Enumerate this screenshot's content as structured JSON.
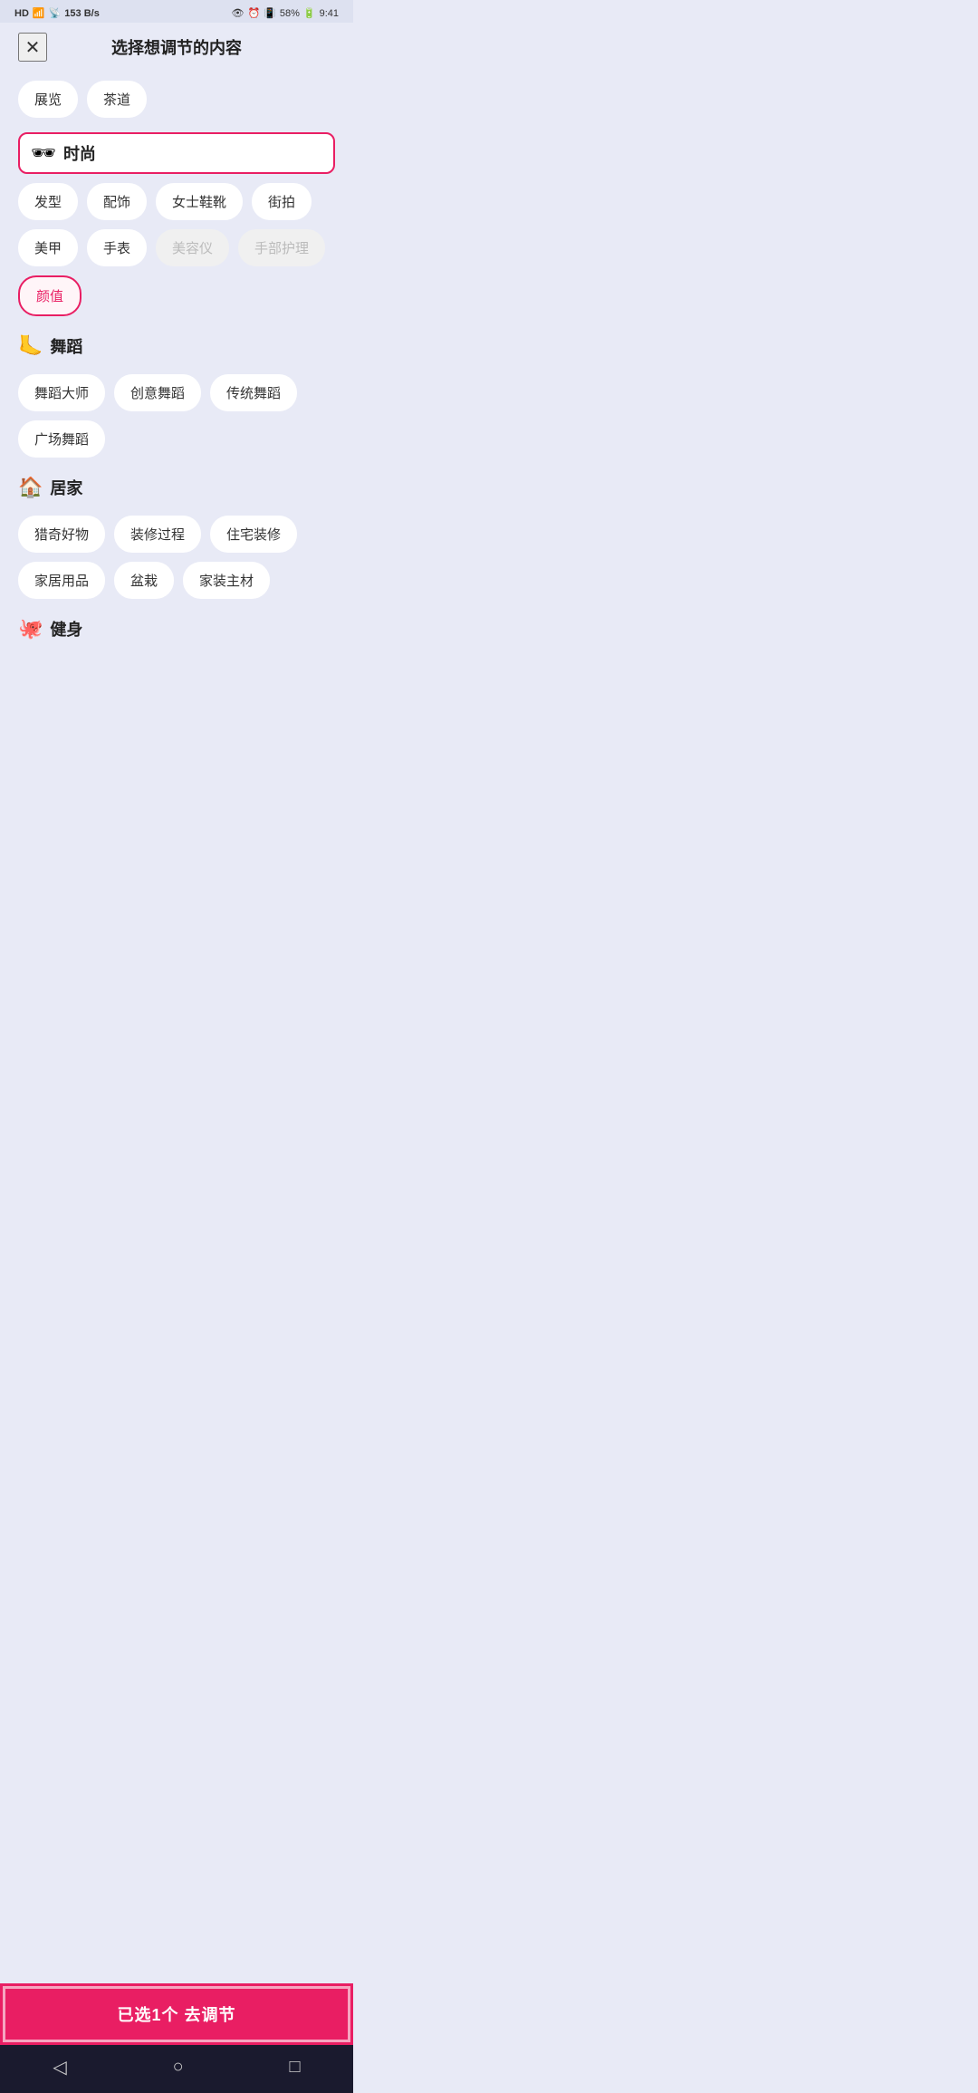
{
  "statusBar": {
    "leftItems": [
      "HD",
      "4G",
      "153 B/s"
    ],
    "rightItems": [
      "👁",
      "⏰",
      "58%",
      "9:41"
    ]
  },
  "header": {
    "title": "选择想调节的内容",
    "closeLabel": "✕"
  },
  "topPills": [
    "展览",
    "茶道"
  ],
  "categories": [
    {
      "id": "fashion",
      "emoji": "🕶",
      "name": "时尚",
      "selected": true,
      "tags": [
        {
          "label": "发型",
          "state": "normal"
        },
        {
          "label": "配饰",
          "state": "normal"
        },
        {
          "label": "女士鞋靴",
          "state": "normal"
        },
        {
          "label": "街拍",
          "state": "normal"
        },
        {
          "label": "美甲",
          "state": "normal"
        },
        {
          "label": "手表",
          "state": "normal"
        },
        {
          "label": "美容仪",
          "state": "disabled"
        },
        {
          "label": "手部护理",
          "state": "disabled"
        }
      ],
      "subSelected": "颜值",
      "subSelectedOutline": true
    },
    {
      "id": "dance",
      "emoji": "🦶",
      "name": "舞蹈",
      "selected": false,
      "tags": [
        {
          "label": "舞蹈大师",
          "state": "normal"
        },
        {
          "label": "创意舞蹈",
          "state": "normal"
        },
        {
          "label": "传统舞蹈",
          "state": "normal"
        },
        {
          "label": "广场舞蹈",
          "state": "normal"
        }
      ]
    },
    {
      "id": "home",
      "emoji": "🏠",
      "name": "居家",
      "selected": false,
      "tags": [
        {
          "label": "猎奇好物",
          "state": "normal"
        },
        {
          "label": "装修过程",
          "state": "normal"
        },
        {
          "label": "住宅装修",
          "state": "normal"
        },
        {
          "label": "家居用品",
          "state": "normal"
        },
        {
          "label": "盆栽",
          "state": "normal"
        },
        {
          "label": "家装主材",
          "state": "normal"
        }
      ]
    },
    {
      "id": "fitness",
      "emoji": "🐙",
      "name": "健身",
      "selected": false,
      "tags": []
    }
  ],
  "actionButton": {
    "label": "已选1个 去调节"
  },
  "navBar": {
    "back": "◁",
    "home": "○",
    "recent": "□"
  }
}
